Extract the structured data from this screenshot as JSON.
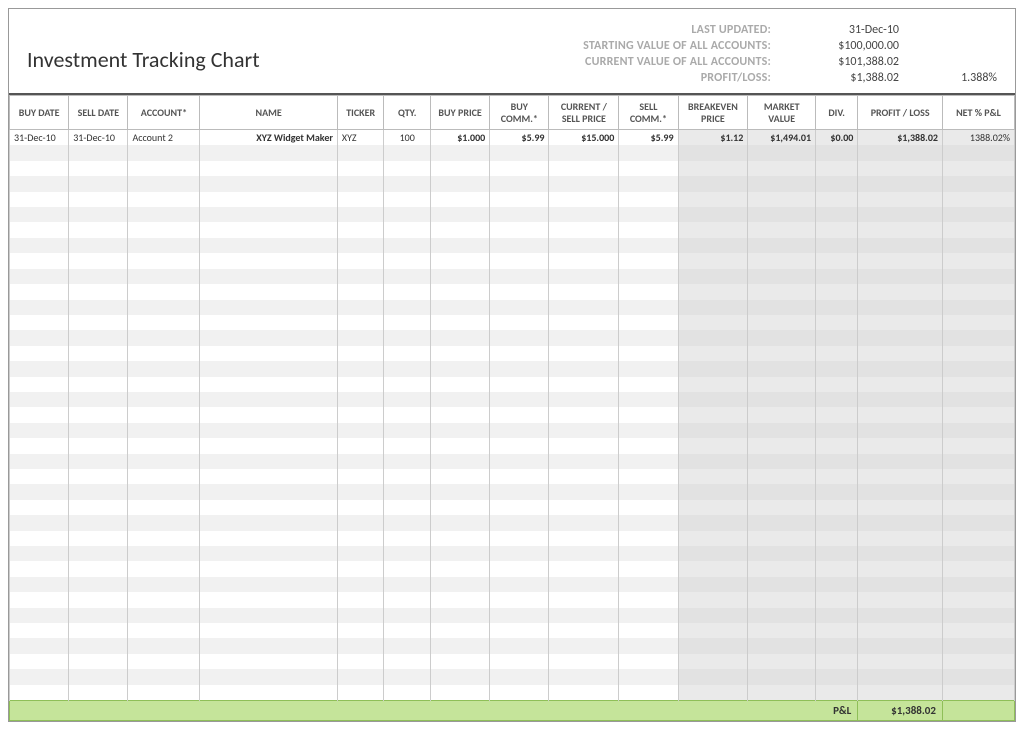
{
  "header": {
    "title": "Investment Tracking Chart",
    "summary": {
      "last_updated_label": "LAST UPDATED:",
      "last_updated_value": "31-Dec-10",
      "starting_value_label": "STARTING VALUE OF ALL ACCOUNTS:",
      "starting_value": "$100,000.00",
      "current_value_label": "CURRENT VALUE OF ALL ACCOUNTS:",
      "current_value": "$101,388.02",
      "profit_loss_label": "PROFIT/LOSS:",
      "profit_loss_value": "$1,388.02",
      "profit_loss_pct": "1.388%"
    }
  },
  "columns": {
    "buy_date": "BUY DATE",
    "sell_date": "SELL DATE",
    "account": "ACCOUNT*",
    "name": "NAME",
    "ticker": "TICKER",
    "qty": "QTY.",
    "buy_price": "BUY PRICE",
    "buy_comm": "BUY COMM.*",
    "sell_price": "CURRENT / SELL PRICE",
    "sell_comm": "SELL COMM.*",
    "breakeven": "BREAKEVEN PRICE",
    "market_value": "MARKET VALUE",
    "div": "DIV.",
    "profit_loss": "PROFIT / LOSS",
    "net_pct": "NET % P&L"
  },
  "rows": [
    {
      "buy_date": "31-Dec-10",
      "sell_date": "31-Dec-10",
      "account": "Account 2",
      "name": "XYZ Widget Maker",
      "ticker": "XYZ",
      "qty": "100",
      "buy_price": "$1.000",
      "buy_comm": "$5.99",
      "sell_price": "$15.000",
      "sell_comm": "$5.99",
      "breakeven": "$1.12",
      "market_value": "$1,494.01",
      "div": "$0.00",
      "profit_loss": "$1,388.02",
      "net_pct": "1388.02%"
    }
  ],
  "totals": {
    "label": "P&L",
    "profit_loss": "$1,388.02"
  },
  "colors": {
    "total_row_bg": "#c5e49a",
    "calc_col_bg": "#eaeaea",
    "stripe_bg": "#f1f1f1"
  }
}
